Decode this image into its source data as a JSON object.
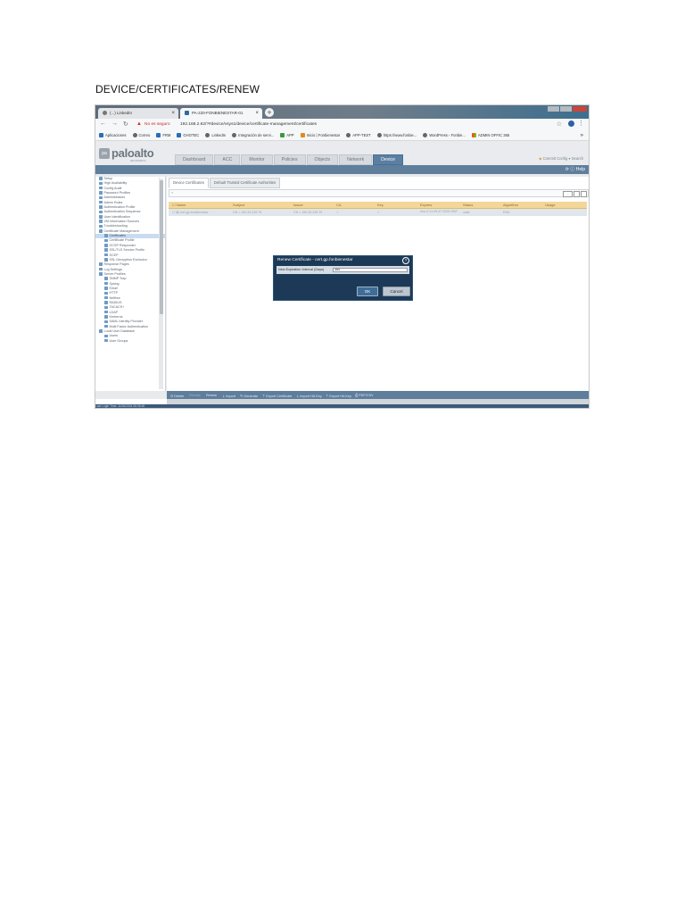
{
  "heading": "DEVICE/CERTIFICATES/RENEW",
  "browser": {
    "tabs": [
      {
        "label": "(...) LinkedIn"
      },
      {
        "label": "PA-220-FONBIENESTAR-01"
      }
    ],
    "address": {
      "security": "No es seguro",
      "url": "192.168.2.62/?#device/vsys1/device/certificate-management/certificates"
    },
    "bookmarks": [
      "Aplicaciones",
      "Correo",
      "FRM",
      "GHOTEC",
      "LinkedIn",
      "Integración de servi...",
      "APP",
      "Inicio | Fonbienestar",
      "APP-TEST",
      "https://www.fonbie...",
      "WordPress › Fonbie...",
      "ADMIN OFFIC 365"
    ]
  },
  "pan": {
    "logo": "paloalto",
    "logo_sub": "NETWORKS",
    "nav_tabs": [
      "Dashboard",
      "ACC",
      "Monitor",
      "Policies",
      "Objects",
      "Network",
      "Device"
    ],
    "header_right": "Commit   Config ▾   Search",
    "help_label": "Help",
    "sidebar": [
      "Setup",
      "High Availability",
      "Config Audit",
      "Password Profiles",
      "Administrators",
      "Admin Roles",
      "Authentication Profile",
      "Authentication Sequence",
      "User Identification",
      "VM Information Sources",
      "Troubleshooting",
      "Certificate Management",
      "Certificates",
      "Certificate Profile",
      "OCSP Responder",
      "SSL/TLS Service Profile",
      "SCEP",
      "SSL Decryption Exclusion",
      "Response Pages",
      "Log Settings",
      "Server Profiles",
      "SNMP Trap",
      "Syslog",
      "Email",
      "HTTP",
      "Netflow",
      "RADIUS",
      "TACACS+",
      "LDAP",
      "Kerberos",
      "SAML Identity Provider",
      "Multi Factor Authentication",
      "Local User Database",
      "Users",
      "User Groups"
    ],
    "main_tabs": [
      "Device Certificates",
      "Default Trusted Certificate Authorities"
    ],
    "columns": [
      "Name",
      "Subject",
      "Issuer",
      "CA",
      "Key",
      "Expires",
      "Status",
      "Algorithm",
      "Usage"
    ],
    "row": [
      "cert.gp.fonbienestar",
      "CN = 190.25.235.79",
      "CN = 190.25.235.79",
      "",
      "",
      "Nov 9 11:49:47 2025 GMT",
      "valid",
      "RSA",
      ""
    ],
    "filter_text": "",
    "footer": [
      "Delete",
      "Revoke",
      "Renew",
      "Import",
      "Generate",
      "Export Certificate",
      "Import HA Key",
      "Export HA Key",
      "PDF/CSV"
    ],
    "status_line": "Last Login Time: 11/06/2024 08:35:48"
  },
  "modal": {
    "title": "Renew Certificate - cert.gp.fonbienestar",
    "label": "New Expiration Interval (Days)",
    "value": "365",
    "ok": "OK",
    "cancel": "Cancel"
  }
}
